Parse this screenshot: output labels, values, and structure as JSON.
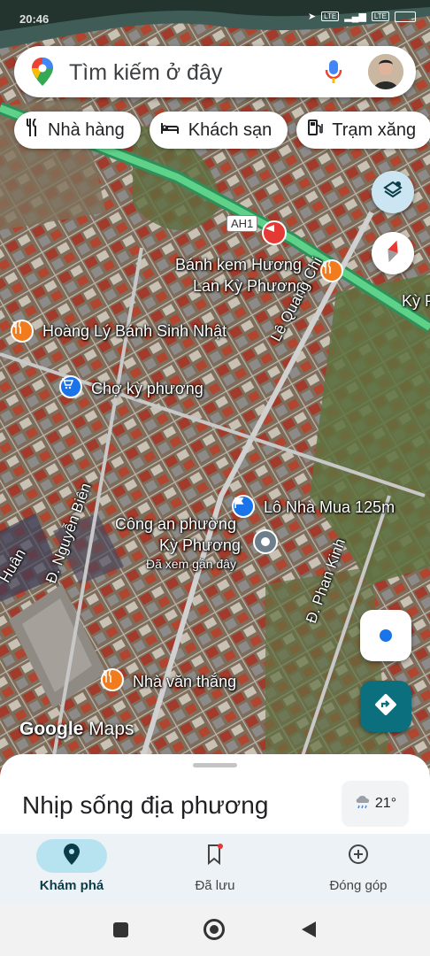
{
  "status_bar": {
    "time": "20:46",
    "icons": [
      "location-arrow-icon",
      "volte-icon",
      "signal-4g-icon",
      "volte-icon",
      "battery-icon"
    ]
  },
  "search": {
    "placeholder": "Tìm kiếm ở đây"
  },
  "chips": [
    {
      "label": "Nhà hàng",
      "icon": "restaurant-icon"
    },
    {
      "label": "Khách sạn",
      "icon": "hotel-icon"
    },
    {
      "label": "Trạm xăng",
      "icon": "gas-station-icon"
    }
  ],
  "map": {
    "road_labels": {
      "highway": "AH1",
      "le_quang_chi": "Lê Quang Chi",
      "nguyen_bien": "Đ. Nguyễn Biên",
      "phan_kinh": "Đ. Phan Kinh",
      "huan": "Huân",
      "ky_partial": "Kỳ P"
    },
    "places": {
      "banh_kem_line1": "Bánh kem Hương",
      "banh_kem_line2": "Lan Kỳ Phương",
      "hoang_ly": "Hoàng Lý Bánh Sinh Nhật",
      "cho": "Chợ kỳ phương",
      "lo_nha": "Lô Nhà Mua 125m",
      "cong_an_line1": "Công an phường",
      "cong_an_line2": "Kỳ Phương",
      "cong_an_sub": "Đã xem gần đây",
      "nha_van_thang": "Nhà văn thắng"
    },
    "watermark": {
      "google": "Google",
      "maps": "Maps"
    }
  },
  "bottom_sheet": {
    "title": "Nhịp sống địa phương",
    "weather_temp": "21°"
  },
  "nav": {
    "items": [
      {
        "label": "Khám phá",
        "active": true
      },
      {
        "label": "Đã lưu",
        "active": false
      },
      {
        "label": "Đóng góp",
        "active": false
      }
    ]
  },
  "colors": {
    "accent_teal": "#0b6f7e",
    "active_pill": "#b7e3f0",
    "poi_orange": "#f07c1e",
    "poi_blue": "#1a73e8",
    "poi_red": "#e53935"
  }
}
